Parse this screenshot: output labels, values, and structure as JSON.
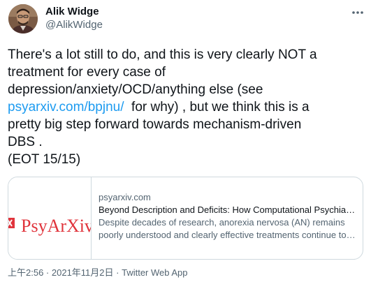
{
  "author": {
    "display_name": "Alik Widge",
    "handle": "@AlikWidge"
  },
  "tweet": {
    "text_before_link": "There's a lot still to do, and this is very clearly NOT a\ntreatment for every case of\ndepression/anxiety/OCD/anything else (see\n",
    "link_text": "psyarxiv.com/bpjnu/",
    "text_after_link": "  for why) , but we think this is a\npretty big step forward towards mechanism-driven\nDBS .\n(EOT 15/15)"
  },
  "card": {
    "thumbnail_text": "PsyArXiv",
    "domain": "psyarxiv.com",
    "title": "Beyond Description and Deficits: How Computational Psychiatry Can Enhance an Understanding of Decision-Making in Anorexia Nervosa",
    "description_line1": "Despite decades of research, anorexia nervosa (AN) remains",
    "description_line2": "poorly understood and clearly effective treatments continue to elude clinicians and researchers."
  },
  "meta": {
    "time": "上午2:56",
    "separator": " · ",
    "date": "2021年11月2日",
    "separator2": " · ",
    "app": "Twitter Web App"
  },
  "colors": {
    "link": "#1d9bf0",
    "text": "#0f1419",
    "secondary": "#536471",
    "border": "#cfd9de",
    "psyarxiv_red": "#e0343c"
  },
  "icons": {
    "more": "more-horizontal-icon",
    "thumbnail_logo": "psyarxiv-logo"
  }
}
